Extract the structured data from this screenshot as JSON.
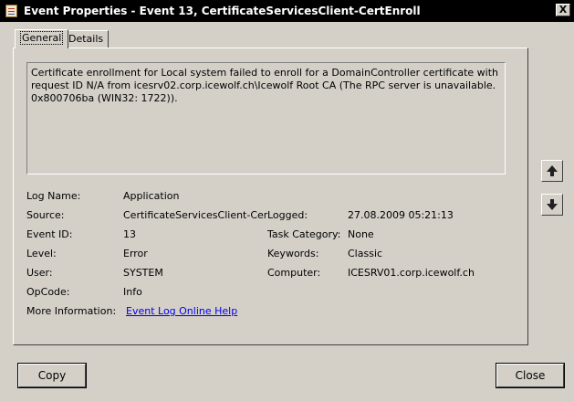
{
  "window": {
    "title": "Event Properties - Event 13, CertificateServicesClient-CertEnroll",
    "close_glyph": "X"
  },
  "tabs": [
    {
      "label": "General"
    },
    {
      "label": "Details"
    }
  ],
  "description": "Certificate enrollment for Local system failed to enroll for a DomainController certificate with request ID N/A from icesrv02.corp.icewolf.ch\\Icewolf Root CA (The RPC server is unavailable. 0x800706ba (WIN32: 1722)).",
  "fields": {
    "log_name": {
      "label": "Log Name:",
      "value": "Application"
    },
    "source": {
      "label": "Source:",
      "value": "CertificateServicesClient-Cer"
    },
    "logged": {
      "label": "Logged:",
      "value": "27.08.2009 05:21:13"
    },
    "event_id": {
      "label": "Event ID:",
      "value": "13"
    },
    "task_category": {
      "label": "Task Category:",
      "value": "None"
    },
    "level": {
      "label": "Level:",
      "value": "Error"
    },
    "keywords": {
      "label": "Keywords:",
      "value": "Classic"
    },
    "user": {
      "label": "User:",
      "value": "SYSTEM"
    },
    "computer": {
      "label": "Computer:",
      "value": "ICESRV01.corp.icewolf.ch"
    },
    "opcode": {
      "label": "OpCode:",
      "value": "Info"
    },
    "more_info": {
      "label": "More Information:",
      "value": "Event Log Online Help"
    }
  },
  "buttons": {
    "copy": "Copy",
    "close": "Close"
  },
  "icons": [
    "app-icon",
    "arrow-up-icon",
    "arrow-down-icon"
  ],
  "colors": {
    "link": "#0000ee",
    "titlebar": "#000000",
    "face": "#d4d0c8"
  }
}
